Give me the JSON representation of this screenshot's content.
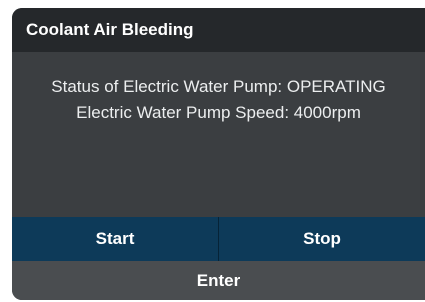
{
  "dialog": {
    "title": "Coolant Air Bleeding",
    "status_line": "Status of Electric Water Pump: OPERATING",
    "speed_line": "Electric Water Pump Speed: 4000rpm"
  },
  "buttons": {
    "start_label": "Start",
    "stop_label": "Stop",
    "enter_label": "Enter"
  },
  "colors": {
    "title_bar": "#25282b",
    "body": "#3b3e41",
    "action_buttons": "#0d3a59",
    "enter_button": "#4a4d50",
    "text": "#ffffff"
  }
}
